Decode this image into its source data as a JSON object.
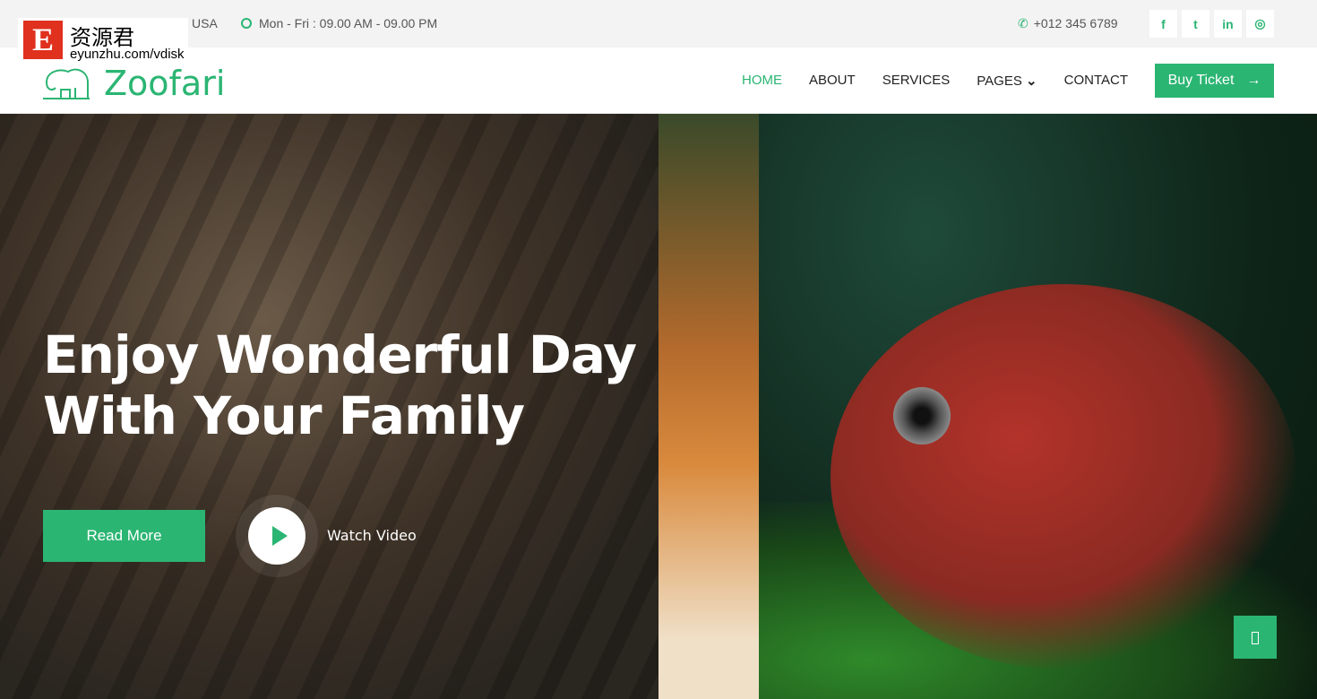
{
  "watermark": {
    "letter": "E",
    "chinese": "资源君",
    "url": "eyunzhu.com/vdisk"
  },
  "topbar": {
    "address": "USA",
    "hours": "Mon - Fri : 09.00 AM - 09.00 PM",
    "phone": "+012 345 6789",
    "social": [
      {
        "icon": "facebook-icon",
        "glyph": "f"
      },
      {
        "icon": "twitter-icon",
        "glyph": "t"
      },
      {
        "icon": "linkedin-icon",
        "glyph": "in"
      },
      {
        "icon": "instagram-icon",
        "glyph": "◎"
      }
    ]
  },
  "brand": {
    "name": "Zoofari",
    "color": "#2bb573"
  },
  "nav": {
    "items": [
      "HOME",
      "ABOUT",
      "SERVICES",
      "PAGES",
      "CONTACT"
    ],
    "dropdown_glyph": "⌄",
    "buy_label": "Buy Ticket",
    "arrow": "→"
  },
  "hero": {
    "title_line1": "Enjoy Wonderful Day",
    "title_line2": "With Your Family",
    "read_more": "Read More",
    "watch_video": "Watch Video"
  }
}
